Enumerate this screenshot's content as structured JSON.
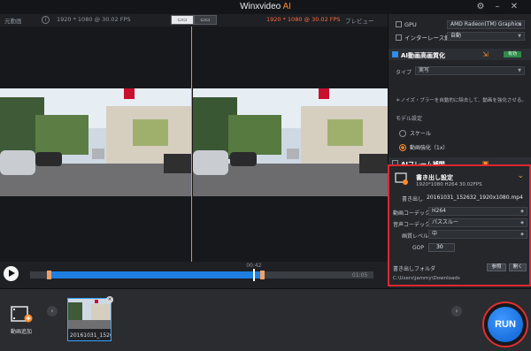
{
  "app": {
    "title": "Winxvideo",
    "title_ai": "AI"
  },
  "preview": {
    "original_label": "元動画",
    "original_res": "1920 * 1080 @ 30.02 FPS",
    "output_res": "1920 * 1080 @ 30.02 FPS",
    "preview_label": "プレビュー",
    "time_mid": "00:42",
    "time_end": "01:05",
    "trim_start": 0.06,
    "trim_end": 0.67,
    "playhead": 0.65
  },
  "side": {
    "gpu_label": "GPU",
    "gpu_value": "AMD Radeon(TM) Graphics",
    "deinterlace_label": "インターレース解除",
    "deinterlace_value": "自動",
    "ai_section_title": "AI動画高画質化",
    "ai_badge": "有効",
    "type_label": "タイプ",
    "type_value": "実写",
    "ai_desc": "＊ノイズ・ブラーを自動的に除去して、動画を強化させる。",
    "model_label": "モデル設定",
    "option_scale": "スケール",
    "option_enhance": "動画強化（1x）",
    "interp_title": "AIフレーム補間"
  },
  "export": {
    "title": "書き出し設定",
    "subtitle": "1920*1080  H264  30.02FPS",
    "filename_label": "書き出し",
    "filename": "20161031_152632_1920x1080.mp4",
    "vcodec_label": "動画コーデック",
    "vcodec_value": "H264",
    "acodec_label": "音声コーデック",
    "acodec_value": "パススルー",
    "quality_label": "画質レベル",
    "quality_value": "中",
    "gop_label": "GOP",
    "gop_value": "30",
    "folder_label": "書き出しフォルダ",
    "browse_btn": "参照",
    "open_btn": "開く",
    "path": "C:\\Users\\jammy\\Downloads"
  },
  "bottom": {
    "add_video_label": "動画追加",
    "thumb_label": "20161031_1526...",
    "run_label": "RUN"
  },
  "colors": {
    "accent_orange": "#ff8a2a",
    "accent_blue": "#1f7ee0",
    "highlight_red": "#e0262d"
  }
}
